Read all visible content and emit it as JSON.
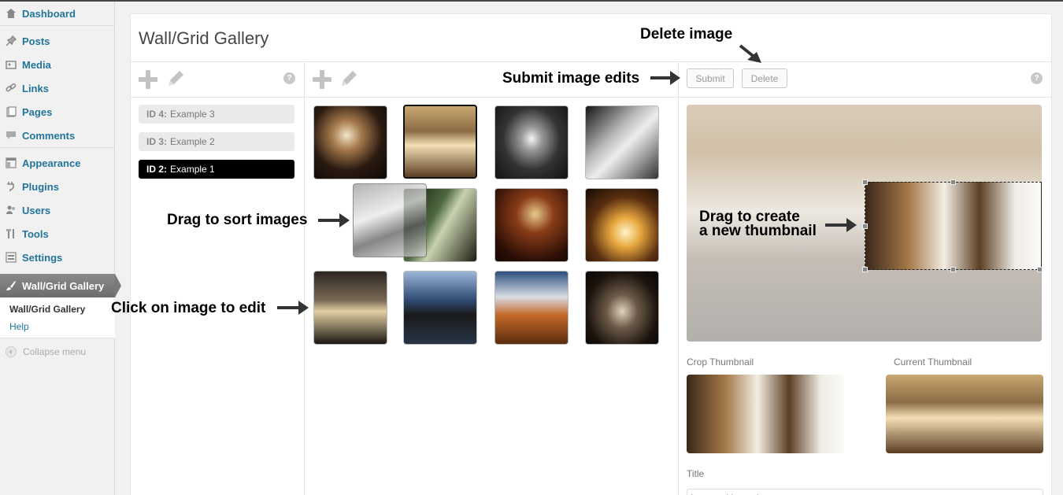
{
  "sidebar": {
    "items": [
      {
        "label": "Dashboard",
        "icon": "dashboard-icon"
      },
      {
        "label": "Posts",
        "icon": "pin-icon"
      },
      {
        "label": "Media",
        "icon": "media-icon"
      },
      {
        "label": "Links",
        "icon": "link-icon"
      },
      {
        "label": "Pages",
        "icon": "pages-icon"
      },
      {
        "label": "Comments",
        "icon": "comments-icon"
      },
      {
        "label": "Appearance",
        "icon": "appearance-icon"
      },
      {
        "label": "Plugins",
        "icon": "plugin-icon"
      },
      {
        "label": "Users",
        "icon": "users-icon"
      },
      {
        "label": "Tools",
        "icon": "tools-icon"
      },
      {
        "label": "Settings",
        "icon": "settings-icon"
      }
    ],
    "current": {
      "label": "Wall/Grid Gallery",
      "icon": "brush-icon"
    },
    "submenu": [
      "Wall/Grid Gallery",
      "Help"
    ],
    "collapse": "Collapse menu"
  },
  "page": {
    "title": "Wall/Grid Gallery"
  },
  "galleries": [
    {
      "id": "ID 4:",
      "name": "Example 3",
      "active": false
    },
    {
      "id": "ID 3:",
      "name": "Example 2",
      "active": false
    },
    {
      "id": "ID 2:",
      "name": "Example 1",
      "active": true
    }
  ],
  "editor": {
    "submit_label": "Submit",
    "delete_label": "Delete",
    "crop_label": "Crop Thumbnail",
    "current_label": "Current Thumbnail",
    "title_label": "Title",
    "title_value": "Image with caption"
  },
  "annotations": {
    "delete": "Delete image",
    "submit": "Submit image edits",
    "sort": "Drag to sort images",
    "edit": "Click on image to edit",
    "thumb_line1": "Drag to create",
    "thumb_line2": "a new thumbnail"
  },
  "colors": {
    "link": "#21759b",
    "active_gallery": "#000000",
    "current_menu": "#7a7a7a"
  }
}
